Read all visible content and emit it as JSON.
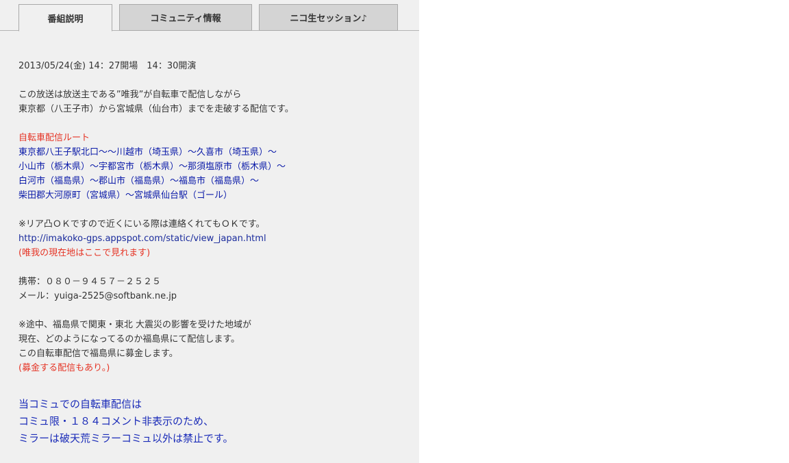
{
  "tabs": [
    {
      "label": "番組説明",
      "active": true
    },
    {
      "label": "コミュニティ情報",
      "active": false
    },
    {
      "label": "ニコ生セッション♪",
      "active": false
    }
  ],
  "description": {
    "datetime": "2013/05/24(金) 14：27開場　14：30開演",
    "intro": [
      "この放送は放送主である”唯我”が自転車で配信しながら",
      "東京都（八王子市）から宮城県（仙台市）までを走破する配信です。"
    ],
    "route_heading": "自転車配信ルート",
    "route": [
      "東京都八王子駅北口〜〜川越市（埼玉県）〜久喜市（埼玉県）〜",
      "小山市（栃木県）〜宇都宮市（栃木県）〜那須塩原市（栃木県）〜",
      "白河市（福島県）〜郡山市（福島県）〜福島市（福島県）〜",
      "柴田郡大河原町（宮城県）〜宮城県仙台駅（ゴール）"
    ],
    "rear_note": "※リア凸ＯＫですので近くにいる際は連絡くれてもＯＫです。",
    "map_link": "http://imakoko-gps.appspot.com/static/view_japan.html",
    "map_note": "(唯我の現在地はここで見れます)",
    "phone": "携帯：０８０－９４５７－２５２５",
    "mail": "メール：yuiga-2525@softbank.ne.jp",
    "fukushima": [
      "※途中、福島県で関東・東北 大震災の影響を受けた地域が",
      "現在、どのようになってるのか福島県にて配信します。",
      "この自転車配信で福島県に募金します。"
    ],
    "donation_note": "(募金する配信もあり。)"
  },
  "notice": [
    "当コミュでの自転車配信は",
    "コミュ限・１８４コメント非表示のため、",
    "ミラーは破天荒ミラーコミュ以外は禁止です。"
  ],
  "colors": {
    "panel_bg": "#f0f0f0",
    "tab_inactive": "#d4d4d4",
    "red_text": "#e53425",
    "route_blue": "#0a1aa8",
    "notice_blue": "#1a2bb8"
  }
}
